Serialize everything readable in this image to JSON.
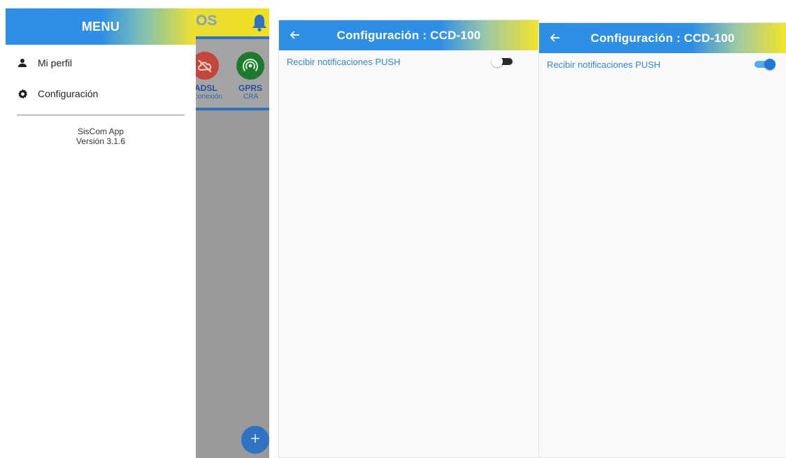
{
  "colors": {
    "primary": "#2f8ee6",
    "accent_yellow": "#f2e12a",
    "label_blue": "#3286cf",
    "toggle_on": "#1f78d6"
  },
  "menu_screen": {
    "background": {
      "appbar_title": "OS",
      "statuses": [
        {
          "label": "ADSL",
          "sublabel": "conexión",
          "icon": "cloud-off-icon",
          "color": "#c4453a"
        },
        {
          "label": "GPRS",
          "sublabel": "CRA",
          "icon": "antenna-icon",
          "color": "#1f7a2e"
        }
      ],
      "fab_icon": "+"
    },
    "drawer": {
      "title": "MENU",
      "items": [
        {
          "label": "Mi perfil",
          "icon": "person-icon"
        },
        {
          "label": "Configuración",
          "icon": "gear-icon"
        }
      ],
      "app_name": "SisCom App",
      "version": "Versión 3.1.6"
    }
  },
  "config_off": {
    "title": "Configuración :  CCD-100",
    "setting_label": "Recibir notificaciones PUSH",
    "push_enabled": false
  },
  "config_on": {
    "title": "Configuración :  CCD-100",
    "setting_label": "Recibir notificaciones PUSH",
    "push_enabled": true
  }
}
